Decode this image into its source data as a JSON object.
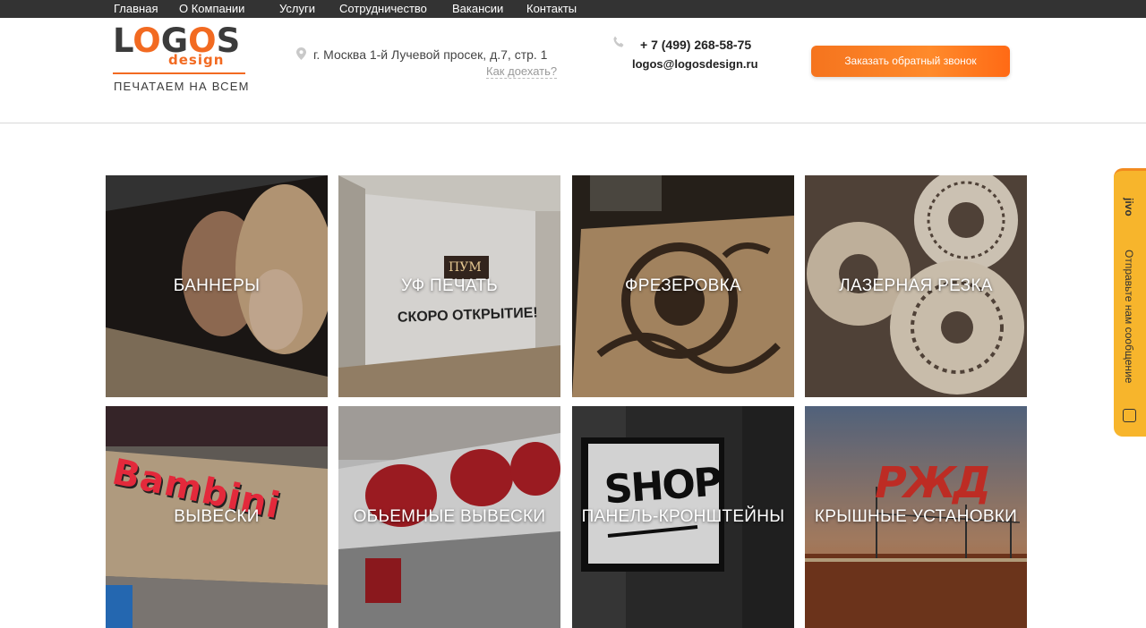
{
  "topnav": {
    "items": [
      "Главная",
      "О Компании",
      "Услуги",
      "Сотрудничество",
      "Вакансии",
      "Контакты"
    ]
  },
  "header": {
    "logo": {
      "word_lo": "L",
      "word_o1": "O",
      "word_g": "G",
      "word_o2": "O",
      "word_s": "S",
      "sub": "design",
      "tagline": "ПЕЧАТАЕМ НА ВСЕМ"
    },
    "address": "г. Москва 1-й Лучевой просек, д.7, стр. 1",
    "route_link": "Как доехать?",
    "phone": "+ 7 (499) 268-58-75",
    "email": "logos@logosdesign.ru",
    "callback_button": "Заказать обратный звонок"
  },
  "services": [
    {
      "label": "БАННЕРЫ"
    },
    {
      "label": "УФ ПЕЧАТЬ",
      "photo_text_1": "ПУМ",
      "photo_text_2": "СКОРО ОТКРЫТИЕ!"
    },
    {
      "label": "ФРЕЗЕРОВКА"
    },
    {
      "label": "ЛАЗЕРНАЯ РЕЗКА"
    },
    {
      "label": "ВЫВЕСКИ",
      "photo_text_1": "Bambini"
    },
    {
      "label": "ОБЬЕМНЫЕ ВЫВЕСКИ"
    },
    {
      "label": "ПАНЕЛЬ-КРОНШТЕЙНЫ",
      "photo_text_1": "SHOP"
    },
    {
      "label": "КРЫШНЫЕ УСТАНОВКИ",
      "photo_text_1": "РЖД"
    }
  ],
  "chat_widget": {
    "brand": "jivo",
    "text": "Отправьте нам сообщение"
  },
  "colors": {
    "accent": "#f26a21",
    "topbar": "#333333",
    "chat": "#f7b52c"
  }
}
